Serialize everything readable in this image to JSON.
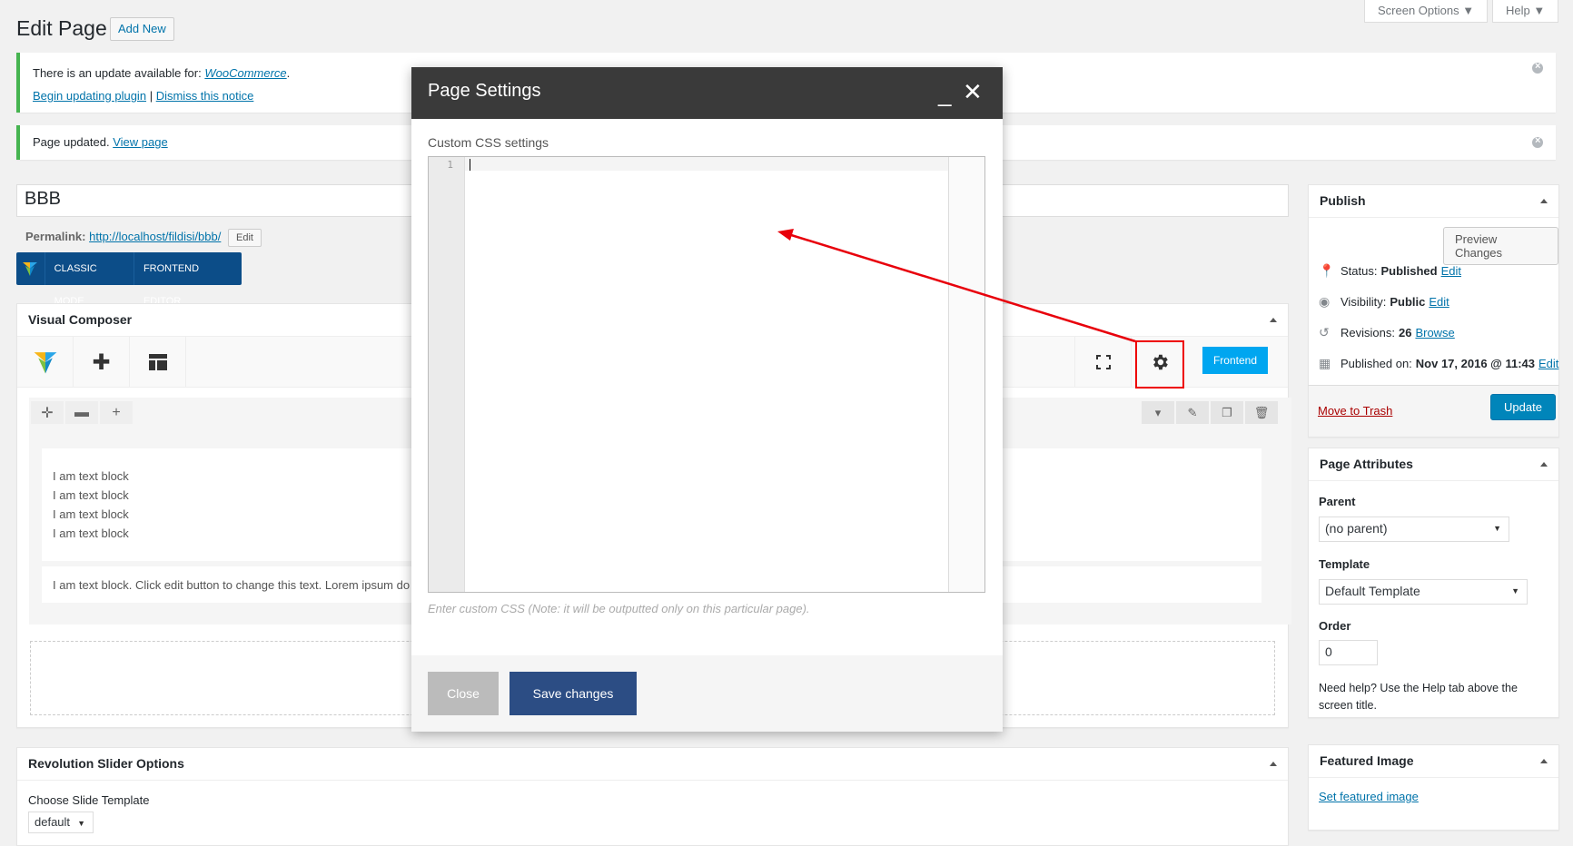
{
  "header": {
    "title": "Edit Page",
    "add_new": "Add New",
    "screen_options": "Screen Options ▼",
    "help": "Help ▼"
  },
  "notices": {
    "update_text": "There is an update available for:",
    "update_plugin": "WooCommerce",
    "begin_updating": "Begin updating plugin",
    "separator": "|",
    "dismiss": "Dismiss this notice",
    "page_updated": "Page updated.",
    "view_page": "View page"
  },
  "editor": {
    "title_value": "BBB",
    "permalink_label": "Permalink:",
    "permalink_url": "http://localhost/fildisi/bbb/",
    "permalink_edit": "Edit",
    "classic_mode": "CLASSIC MODE",
    "frontend_editor": "FRONTEND EDITOR"
  },
  "vc": {
    "title": "Visual Composer",
    "frontend": "Frontend",
    "text_block_lines": [
      "I am text block",
      "I am text block",
      "I am text block",
      "I am text block"
    ],
    "text_block_2": "I am text block. Click edit button to change this text. Lorem ipsum do"
  },
  "revslider": {
    "title": "Revolution Slider Options",
    "template_label": "Choose Slide Template",
    "template_value": "default"
  },
  "publish": {
    "title": "Publish",
    "preview": "Preview Changes",
    "status_label": "Status:",
    "status_value": "Published",
    "visibility_label": "Visibility:",
    "visibility_value": "Public",
    "revisions_label": "Revisions:",
    "revisions_value": "26",
    "browse": "Browse",
    "published_label": "Published on:",
    "published_value": "Nov 17, 2016 @ 11:43",
    "edit": "Edit",
    "trash": "Move to Trash",
    "update": "Update"
  },
  "page_attributes": {
    "title": "Page Attributes",
    "parent_label": "Parent",
    "parent_value": "(no parent)",
    "template_label": "Template",
    "template_value": "Default Template",
    "order_label": "Order",
    "order_value": "0",
    "help": "Need help? Use the Help tab above the screen title."
  },
  "featured_image": {
    "title": "Featured Image",
    "set": "Set featured image"
  },
  "modal": {
    "title": "Page Settings",
    "css_label": "Custom CSS settings",
    "line_number": "1",
    "hint": "Enter custom CSS (Note: it will be outputted only on this particular page).",
    "close": "Close",
    "save": "Save changes"
  },
  "colors": {
    "annotation": "#e8000b",
    "vc_blue": "#0c4d88",
    "save_blue": "#2c4d84",
    "wp_blue": "#0085ba"
  }
}
